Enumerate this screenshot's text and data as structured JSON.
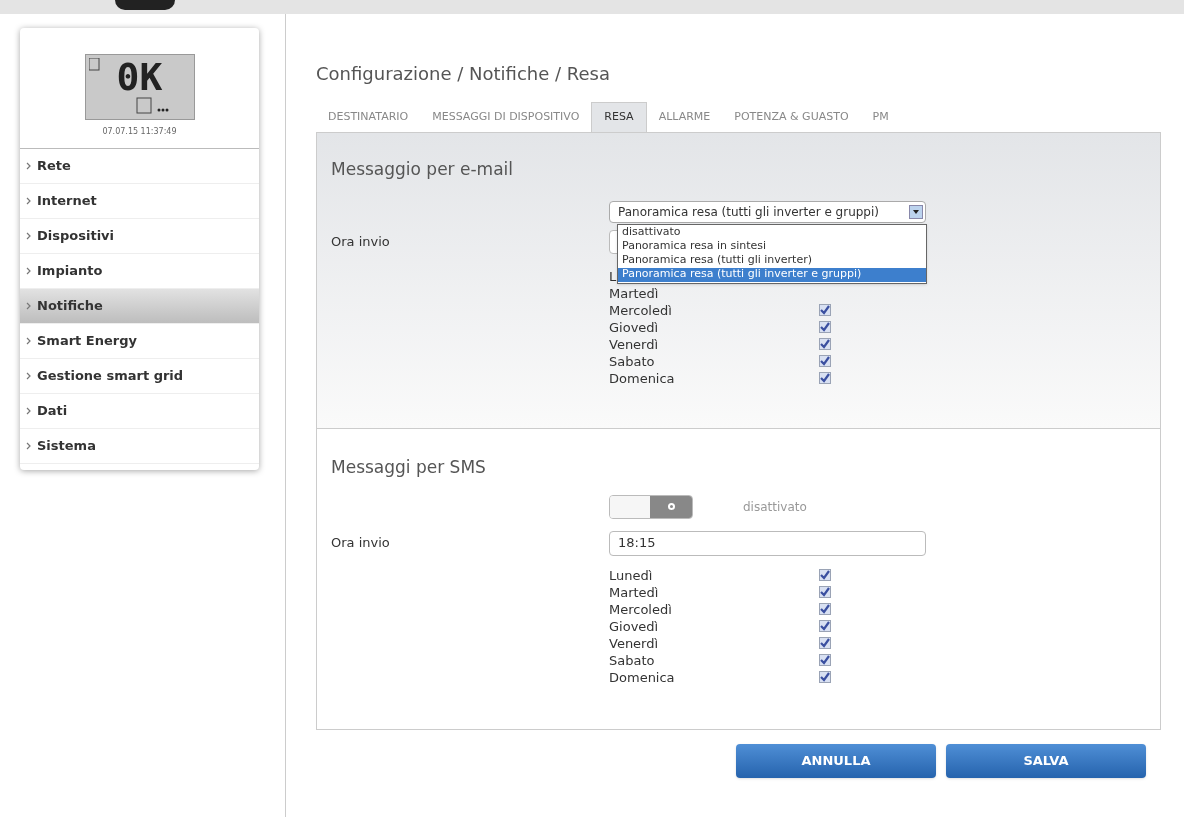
{
  "device": {
    "display": "0K",
    "timestamp": "07.07.15 11:37:49"
  },
  "sidebar": {
    "items": [
      {
        "label": "Rete",
        "selected": false
      },
      {
        "label": "Internet",
        "selected": false
      },
      {
        "label": "Dispositivi",
        "selected": false
      },
      {
        "label": "Impianto",
        "selected": false
      },
      {
        "label": "Notifiche",
        "selected": true
      },
      {
        "label": "Smart Energy",
        "selected": false
      },
      {
        "label": "Gestione smart grid",
        "selected": false
      },
      {
        "label": "Dati",
        "selected": false
      },
      {
        "label": "Sistema",
        "selected": false
      }
    ]
  },
  "breadcrumb": "Configurazione / Notifiche / Resa",
  "tabs": [
    {
      "label": "DESTINATARIO",
      "selected": false
    },
    {
      "label": "MESSAGGI DI DISPOSITIVO",
      "selected": false
    },
    {
      "label": "RESA",
      "selected": true
    },
    {
      "label": "ALLARME",
      "selected": false
    },
    {
      "label": "POTENZA & GUASTO",
      "selected": false
    },
    {
      "label": "PM",
      "selected": false
    }
  ],
  "email": {
    "title": "Messaggio per e-mail",
    "select_value": "Panoramica resa (tutti gli inverter e gruppi)",
    "options": [
      {
        "label": "disattivato",
        "selected": false
      },
      {
        "label": "Panoramica resa in sintesi",
        "selected": false
      },
      {
        "label": "Panoramica resa (tutti gli inverter)",
        "selected": false
      },
      {
        "label": "Panoramica resa (tutti gli inverter e gruppi)",
        "selected": true
      }
    ],
    "time_label": "Ora invio",
    "days": [
      {
        "label": "L"
      },
      {
        "label": "Martedì"
      },
      {
        "label": "Mercoledì",
        "checked": true
      },
      {
        "label": "Giovedì",
        "checked": true
      },
      {
        "label": "Venerdì",
        "checked": true
      },
      {
        "label": "Sabato",
        "checked": true
      },
      {
        "label": "Domenica",
        "checked": true
      }
    ]
  },
  "sms": {
    "title": "Messaggi per SMS",
    "toggle_on": false,
    "toggle_label": "disattivato",
    "time_label": "Ora invio",
    "time_value": "18:15",
    "days": [
      {
        "label": "Lunedì",
        "checked": true
      },
      {
        "label": "Martedì",
        "checked": true
      },
      {
        "label": "Mercoledì",
        "checked": true
      },
      {
        "label": "Giovedì",
        "checked": true
      },
      {
        "label": "Venerdì",
        "checked": true
      },
      {
        "label": "Sabato",
        "checked": true
      },
      {
        "label": "Domenica",
        "checked": true
      }
    ]
  },
  "buttons": [
    "ANNULLA",
    "SALVA"
  ]
}
